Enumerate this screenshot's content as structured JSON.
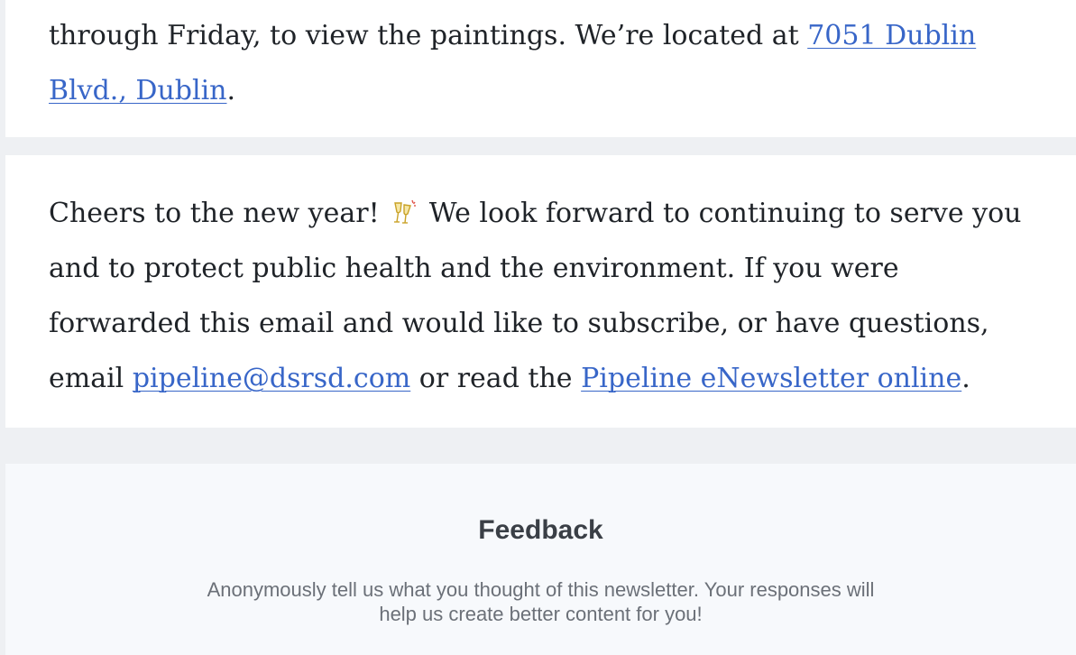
{
  "section1": {
    "text_before": "through Friday, to view the paintings. We’re located at ",
    "address_link": "7051 Dublin Blvd., Dublin",
    "text_after": "."
  },
  "section2": {
    "text_1": "Cheers to the new year! ",
    "emoji_icon": "clinking-glasses-icon",
    "text_2": " We look forward to continuing to serve you and to protect public health and the environment. If you were forwarded this email and would like to subscribe, or have questions, email ",
    "email_link": "pipeline@dsrsd.com",
    "text_3": " or read the ",
    "newsletter_link": "Pipeline eNewsletter online",
    "text_4": "."
  },
  "feedback": {
    "title": "Feedback",
    "description": "Anonymously tell us what you thought of this newsletter. Your responses will help us create better content for you!"
  },
  "colors": {
    "link": "#3866c8",
    "page_background": "#eef0f3",
    "card_background": "#ffffff",
    "feedback_background": "#f7f9fc"
  }
}
